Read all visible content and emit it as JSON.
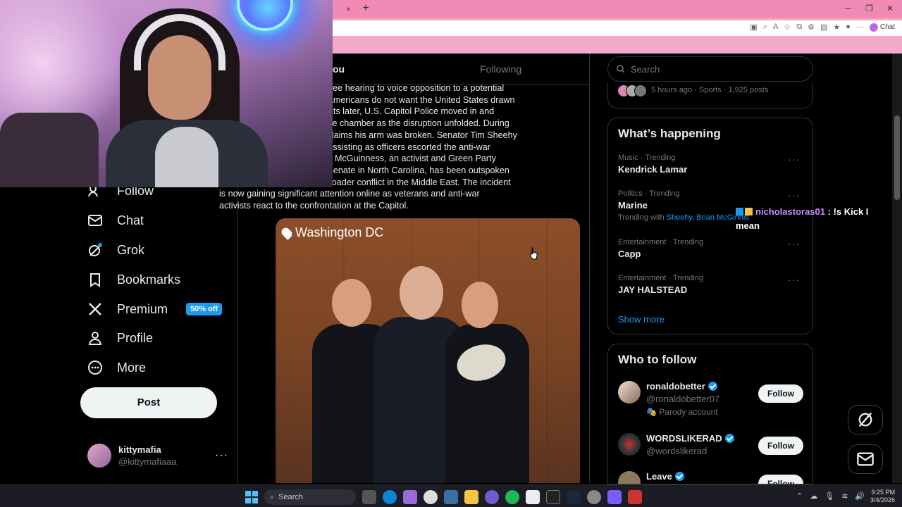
{
  "browser": {
    "new_tab_symbol": "+",
    "tab_close_symbol": "×",
    "chat_label": "Chat",
    "window_controls": [
      "─",
      "❐",
      "✕"
    ]
  },
  "nav": {
    "items": [
      {
        "label": "Follow",
        "icon": "people-icon"
      },
      {
        "label": "Chat",
        "icon": "mail-icon"
      },
      {
        "label": "Grok",
        "icon": "grok-icon"
      },
      {
        "label": "Bookmarks",
        "icon": "bookmark-icon"
      },
      {
        "label": "Premium",
        "icon": "x-logo-icon",
        "badge": "50% off"
      },
      {
        "label": "Profile",
        "icon": "person-icon"
      },
      {
        "label": "More",
        "icon": "more-circle-icon"
      }
    ],
    "post_label": "Post",
    "profile": {
      "name": "kittymafia",
      "handle": "@kittymafiaaa",
      "more": "···"
    }
  },
  "main": {
    "tabs": {
      "for_you": "ou",
      "following": "Following"
    },
    "tweet_lines": [
      "es subcommittee hearing to voice opposition to a potential",
      "saying many Americans do not want the United States drawn",
      "onflict. Moments later, U.S. Capitol Police moved in and",
      "ed him from the chamber as the disruption unfolded. During",
      "McGuinness claims his arm was broken. Senator Tim Sheehy",
      "as also seen assisting as officers escorted the anti-war",
      "of the hearing. McGuinness, an activist and Green Party",
      "ning for U.S. Senate in North Carolina, has been outspoken",
      "ssibility of a broader conflict in the Middle East. The incident",
      "is now gaining significant attention online as veterans and anti-war",
      "activists react to the confrontation at the Capitol."
    ],
    "media_location": "Washington DC"
  },
  "sidebar": {
    "search_placeholder": "Search",
    "sports_meta": "5 hours ago · Sports · 1,925 posts",
    "whats_happening": {
      "title": "What’s happening",
      "trends": [
        {
          "meta": "Music · Trending",
          "name": "Kendrick Lamar"
        },
        {
          "meta": "Politics · Trending",
          "name": "Marine",
          "with_prefix": "Trending with",
          "with_names": "Sheehy, Brian McGinnis"
        },
        {
          "meta": "Entertainment · Trending",
          "name": "Capp"
        },
        {
          "meta": "Entertainment · Trending",
          "name": "JAY HALSTEAD"
        }
      ],
      "dots": "···",
      "show_more": "Show more"
    },
    "who_to_follow": {
      "title": "Who to follow",
      "accounts": [
        {
          "name": "ronaldobetter",
          "handle": "@ronaldobetter07",
          "note": "Parody account",
          "button": "Follow"
        },
        {
          "name": "WORDSLIKERAD",
          "handle": "@wordslikerad",
          "button": "Follow"
        },
        {
          "name": "Leave",
          "handle": "",
          "button": "Follow"
        }
      ]
    }
  },
  "chat_overlay": {
    "username": "nicholastoras01",
    "message": ": !s Kick I mean"
  },
  "taskbar": {
    "search": "Search",
    "time": "9:25 PM",
    "date": "3/4/2026"
  },
  "colors": {
    "accent": "#1d9bf0",
    "browser_pink": "#f3a9c9",
    "tab_pink": "#f18ab5"
  }
}
